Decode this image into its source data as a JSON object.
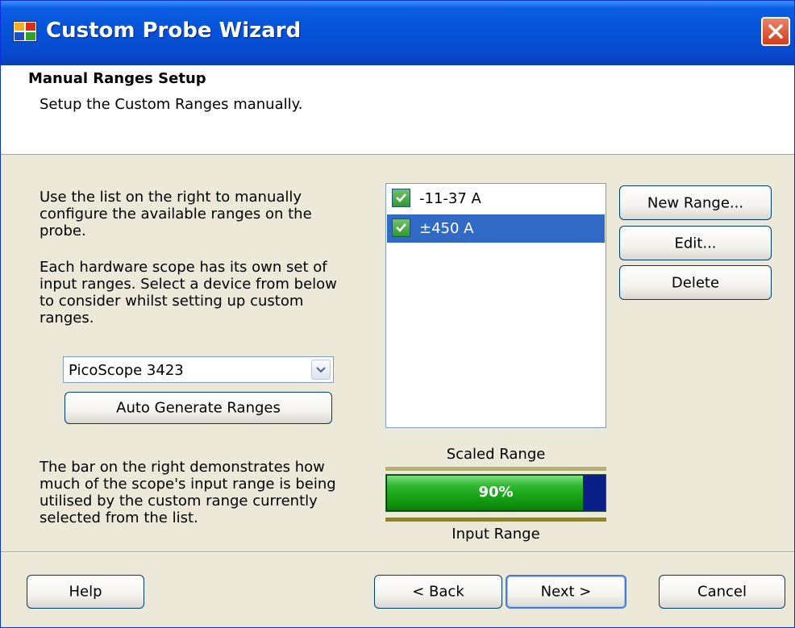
{
  "window": {
    "title": "Custom Probe Wizard",
    "title_icon": "app-window-icon",
    "close_icon": "close-icon"
  },
  "header": {
    "title": "Manual Ranges Setup",
    "subtitle": "Setup the Custom Ranges manually."
  },
  "left": {
    "para1": "Use the list on the right to manually configure the available ranges on the probe.",
    "para2": "Each hardware scope has its own set of input ranges. Select a device from below to consider whilst setting up custom ranges.",
    "device_select": "PicoScope 3423",
    "auto_generate_label": "Auto Generate Ranges",
    "para3": "The bar on the right demonstrates how much of the scope's input range is being utilised by the custom range currently selected from the list."
  },
  "ranges": {
    "items": [
      {
        "label": "-11-37 A",
        "checked": true,
        "selected": false
      },
      {
        "label": "±450 A",
        "checked": true,
        "selected": true
      }
    ]
  },
  "range_buttons": {
    "new_label": "New Range...",
    "edit_label": "Edit...",
    "delete_label": "Delete"
  },
  "usage": {
    "scaled_label": "Scaled Range",
    "input_label": "Input Range",
    "percent_text": "90%",
    "fraction": 0.9
  },
  "footer": {
    "help_label": "Help",
    "back_label": "< Back",
    "next_label": "Next >",
    "cancel_label": "Cancel"
  },
  "colors": {
    "titlebar": "#0552d8",
    "selection": "#316ac5",
    "bar_fill": "#129c12",
    "bar_remaining": "#0a1f88"
  }
}
